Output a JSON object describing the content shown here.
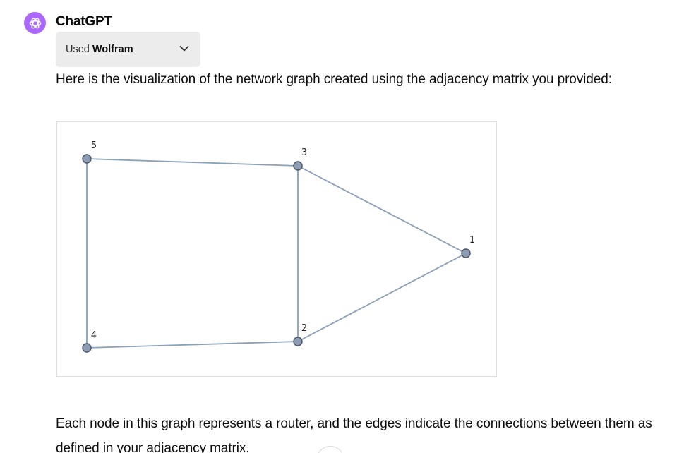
{
  "message": {
    "author": "ChatGPT",
    "avatar_icon": "openai-logo-icon",
    "avatar_color": "#ab68ff",
    "tool_chip": {
      "prefix": "Used",
      "tool_name": "Wolfram",
      "chevron_icon": "chevron-down-icon"
    },
    "intro_text": "Here is the visualization of the network graph created using the adjacency matrix you provided:",
    "graph": {
      "nodes": [
        {
          "id": "1",
          "label": "1"
        },
        {
          "id": "2",
          "label": "2"
        },
        {
          "id": "3",
          "label": "3"
        },
        {
          "id": "4",
          "label": "4"
        },
        {
          "id": "5",
          "label": "5"
        }
      ],
      "edges": [
        [
          "5",
          "3"
        ],
        [
          "5",
          "4"
        ],
        [
          "3",
          "2"
        ],
        [
          "3",
          "1"
        ],
        [
          "2",
          "1"
        ],
        [
          "4",
          "2"
        ]
      ]
    },
    "outro_text": "Each node in this graph represents a router, and the edges indicate the connections between them as defined in your adjacency matrix.",
    "scroll_icon": "arrow-down-icon"
  }
}
